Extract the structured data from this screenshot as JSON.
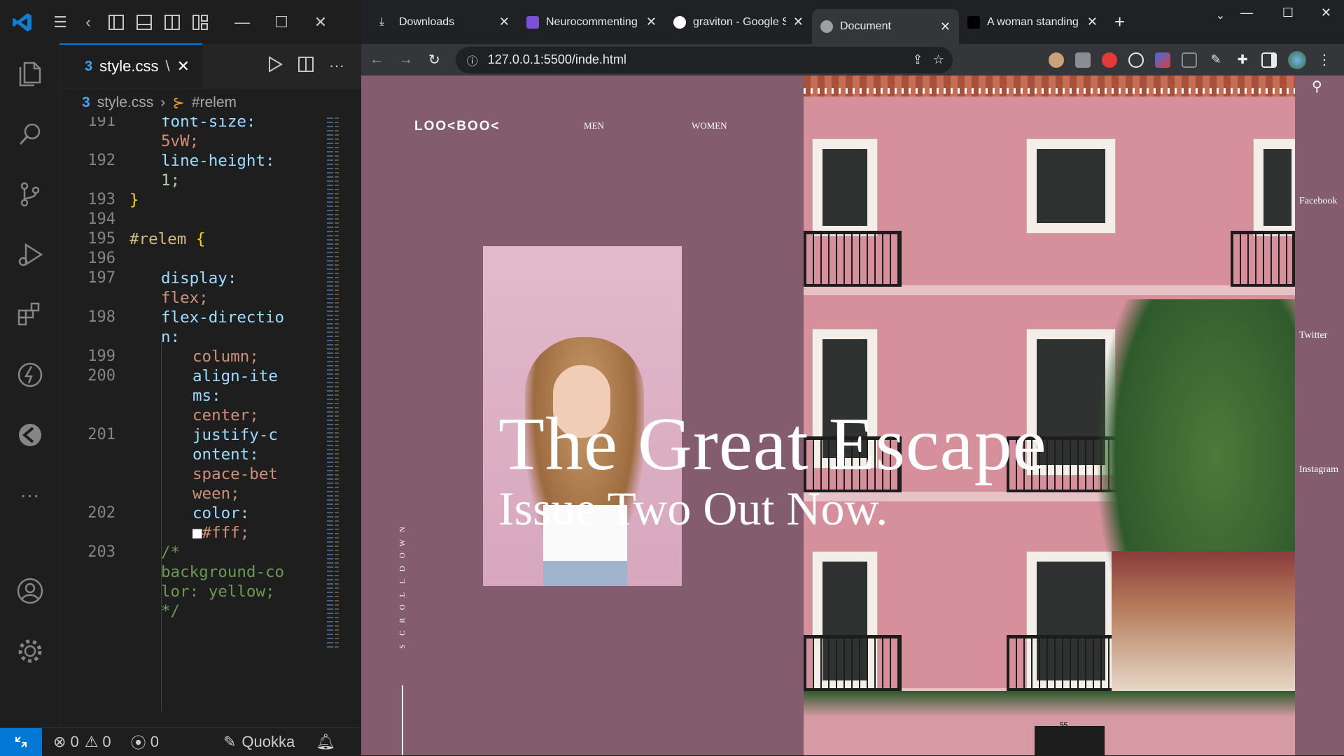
{
  "vscode": {
    "tab": {
      "file": "style.css",
      "badge": "\\",
      "icon": "css-icon"
    },
    "breadcrumb": {
      "file": "style.css",
      "selector": "#relem"
    },
    "lines": [
      {
        "n": "191",
        "indent": 2,
        "parts": [
          [
            "font-size:",
            "#9cdcfe"
          ]
        ]
      },
      {
        "n": "",
        "indent": 2,
        "parts": [
          [
            "5vW;",
            "#ce9178"
          ]
        ]
      },
      {
        "n": "192",
        "indent": 2,
        "parts": [
          [
            "line-height:",
            "#9cdcfe"
          ]
        ]
      },
      {
        "n": "",
        "indent": 2,
        "parts": [
          [
            "1;",
            "#b5cea8"
          ]
        ]
      },
      {
        "n": "193",
        "indent": 0,
        "parts": [
          [
            "}",
            "#ffd700"
          ]
        ]
      },
      {
        "n": "194",
        "indent": 0,
        "parts": []
      },
      {
        "n": "195",
        "indent": 0,
        "parts": [
          [
            "#relem ",
            "#d7ba7d"
          ],
          [
            "{",
            "#ffd700"
          ]
        ]
      },
      {
        "n": "196",
        "indent": 0,
        "parts": []
      },
      {
        "n": "197",
        "indent": 2,
        "parts": [
          [
            "display:",
            "#9cdcfe"
          ]
        ]
      },
      {
        "n": "",
        "indent": 2,
        "parts": [
          [
            "flex;",
            "#ce9178"
          ]
        ]
      },
      {
        "n": "198",
        "indent": 2,
        "parts": [
          [
            "flex-directio",
            "#9cdcfe"
          ]
        ]
      },
      {
        "n": "",
        "indent": 2,
        "parts": [
          [
            "n:",
            "#9cdcfe"
          ]
        ]
      },
      {
        "n": "199",
        "indent": 4,
        "parts": [
          [
            "column;",
            "#ce9178"
          ]
        ]
      },
      {
        "n": "200",
        "indent": 4,
        "parts": [
          [
            "align-ite",
            "#9cdcfe"
          ]
        ]
      },
      {
        "n": "",
        "indent": 4,
        "parts": [
          [
            "ms:",
            "#9cdcfe"
          ]
        ]
      },
      {
        "n": "",
        "indent": 4,
        "parts": [
          [
            "center;",
            "#ce9178"
          ]
        ]
      },
      {
        "n": "201",
        "indent": 4,
        "parts": [
          [
            "justify-c",
            "#9cdcfe"
          ]
        ]
      },
      {
        "n": "",
        "indent": 4,
        "parts": [
          [
            "ontent:",
            "#9cdcfe"
          ]
        ]
      },
      {
        "n": "",
        "indent": 4,
        "parts": [
          [
            "space-bet",
            "#ce9178"
          ]
        ]
      },
      {
        "n": "",
        "indent": 4,
        "parts": [
          [
            "ween;",
            "#ce9178"
          ]
        ]
      },
      {
        "n": "202",
        "indent": 4,
        "parts": [
          [
            "color:",
            "#9cdcfe"
          ]
        ]
      },
      {
        "n": "",
        "indent": 4,
        "parts": [
          [
            "■",
            "#ffffff"
          ],
          [
            "#fff;",
            "#ce9178"
          ]
        ]
      },
      {
        "n": "203",
        "indent": 2,
        "parts": [
          [
            "/*",
            "#6a9955"
          ]
        ]
      },
      {
        "n": "",
        "indent": 2,
        "parts": [
          [
            "background-co",
            "#6a9955"
          ]
        ]
      },
      {
        "n": "",
        "indent": 2,
        "parts": [
          [
            "lor: yellow;",
            "#6a9955"
          ]
        ]
      },
      {
        "n": "",
        "indent": 2,
        "parts": [
          [
            "*/",
            "#6a9955"
          ]
        ]
      }
    ],
    "status": {
      "errors": "0",
      "warnings": "0",
      "ports": "0",
      "quokka": "Quokka"
    }
  },
  "browser": {
    "tabs": [
      {
        "title": "Downloads",
        "icon": "download-icon",
        "color": "#e8eaed",
        "active": false
      },
      {
        "title": "Neurocommenting",
        "icon": "site-icon",
        "color": "#7b4fd6",
        "active": false
      },
      {
        "title": "graviton - Google S",
        "icon": "google-icon",
        "color": "#ffffff",
        "active": false
      },
      {
        "title": "Document",
        "icon": "globe-icon",
        "color": "#9aa0a6",
        "active": true
      },
      {
        "title": "A woman standing",
        "icon": "unsplash-icon",
        "color": "#000000",
        "active": false
      }
    ],
    "url": "127.0.0.1:5500/inde.html"
  },
  "site": {
    "logo": "LOO<BOO<",
    "nav": [
      "MEN",
      "WOMEN"
    ],
    "headline": "The Great Escape",
    "subline": "Issue Two Out Now.",
    "social": [
      "Facebook",
      "Twitter",
      "Instagram"
    ],
    "scroll": "SCROLLDOWN",
    "door_number": "55"
  }
}
